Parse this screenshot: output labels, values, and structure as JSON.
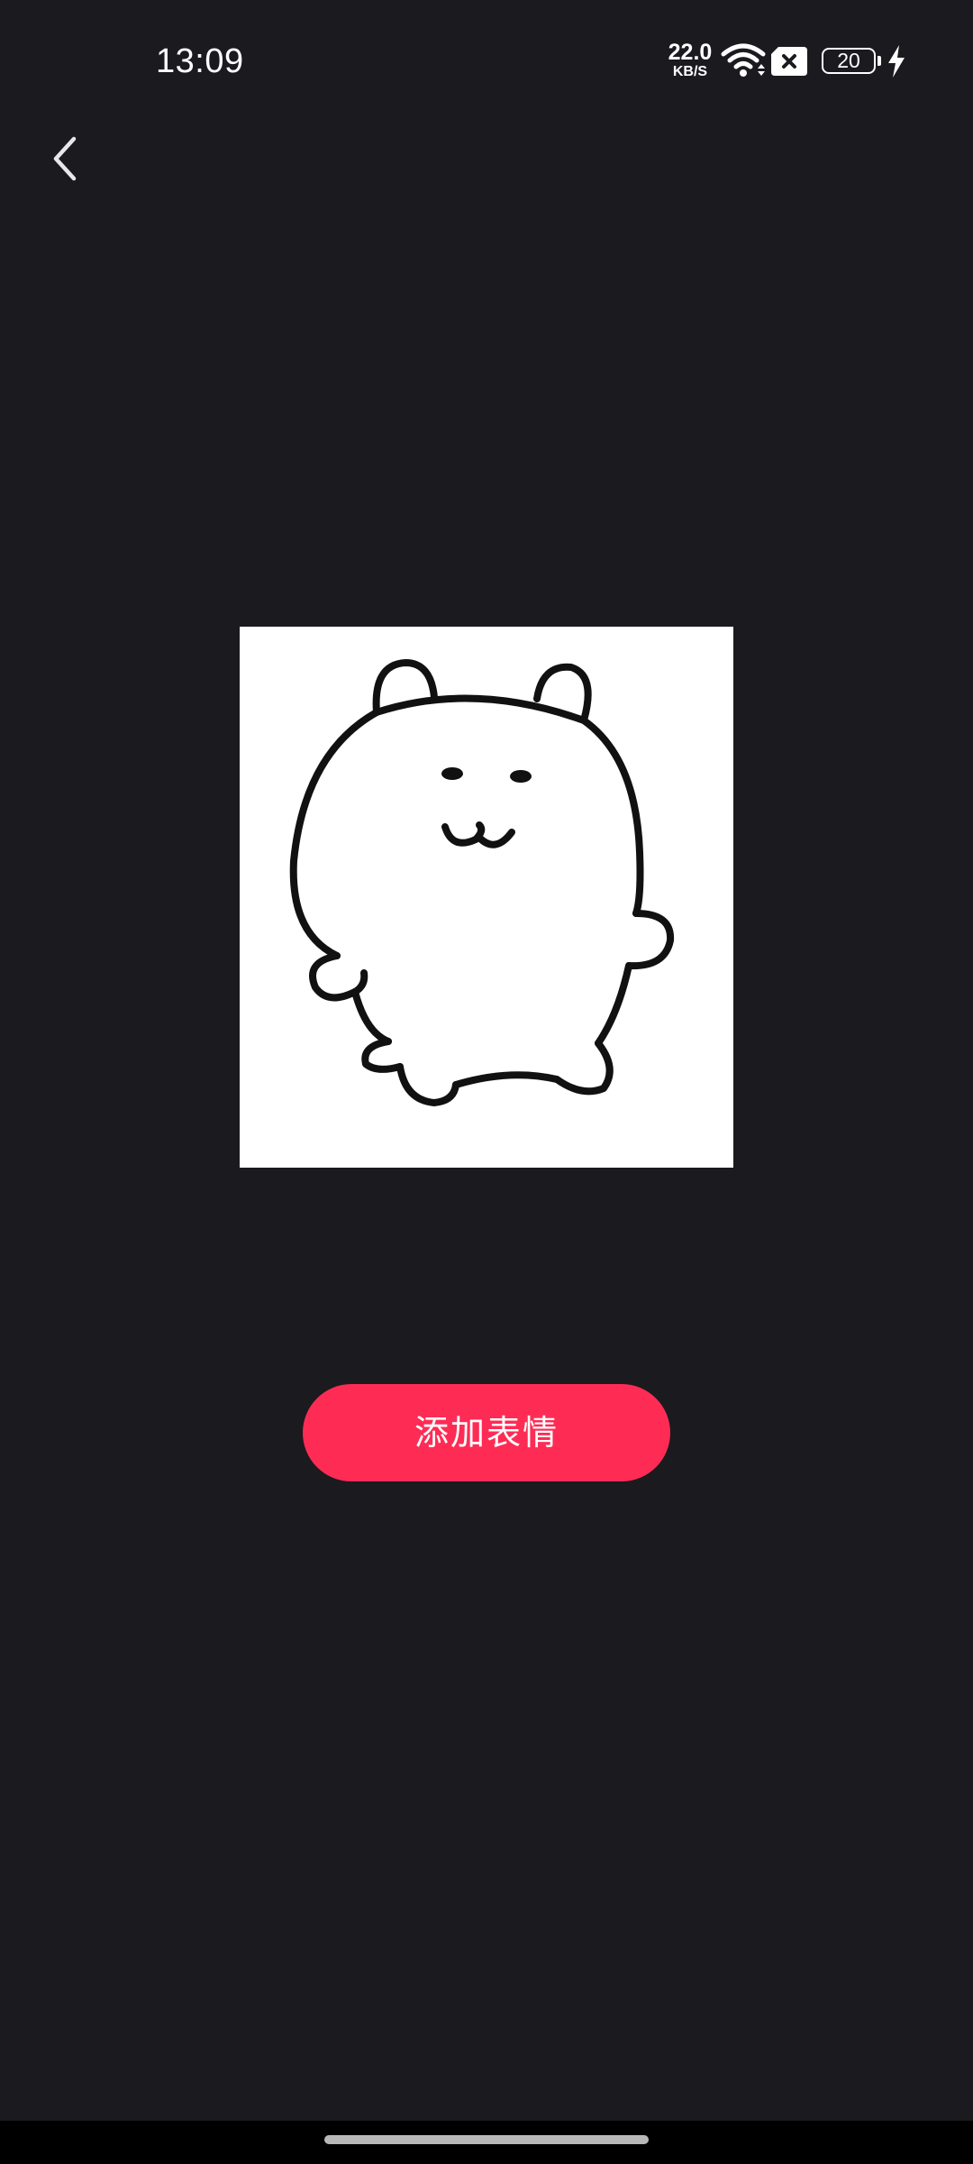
{
  "status_bar": {
    "time": "13:09",
    "net_speed_value": "22.0",
    "net_speed_unit": "KB/S",
    "battery_level": "20",
    "icons": [
      "wifi-icon",
      "sim-off-icon",
      "battery-icon",
      "charging-bolt-icon"
    ]
  },
  "header": {
    "back_icon": "chevron-left-icon"
  },
  "preview": {
    "image_subject": "bear-sticker"
  },
  "actions": {
    "add_label": "添加表情"
  },
  "colors": {
    "background": "#1b1a1f",
    "accent": "#fe2c55",
    "text": "#ffffff"
  }
}
